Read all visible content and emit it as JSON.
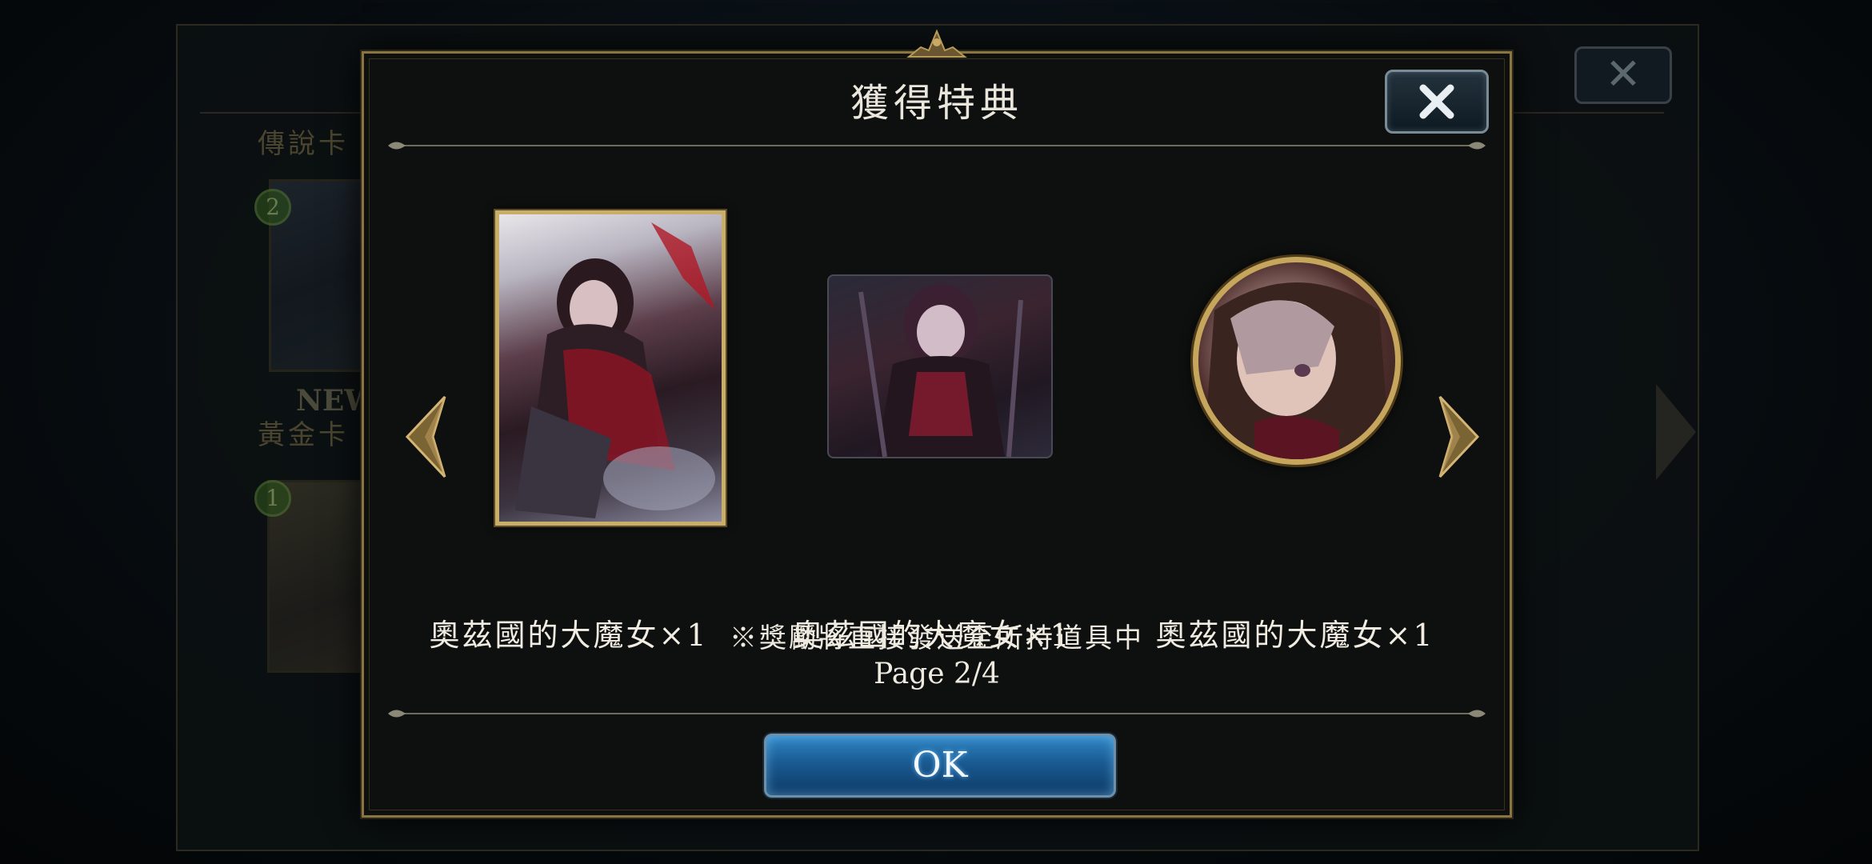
{
  "background": {
    "section_legendary": "傳說卡",
    "section_gold": "黃金卡",
    "new_badge": "NEW",
    "costs": [
      "2",
      "1"
    ]
  },
  "modal": {
    "title": "獲得特典",
    "rewards": [
      {
        "label": "奧茲國的大魔女×1",
        "kind": "card"
      },
      {
        "label": "奧茲國的大魔女×1",
        "kind": "sleeve"
      },
      {
        "label": "奧茲國的大魔女×1",
        "kind": "emblem"
      }
    ],
    "note": "※獎勵將直接發送至所持道具中",
    "page": "Page 2/4",
    "ok_label": "OK"
  },
  "colors": {
    "frame_gold": "#8a7440",
    "ok_button": "#1a5a92",
    "text": "#f0ece2"
  },
  "icons": [
    "close-icon",
    "chevron-left-icon",
    "chevron-right-icon",
    "crest-icon"
  ]
}
